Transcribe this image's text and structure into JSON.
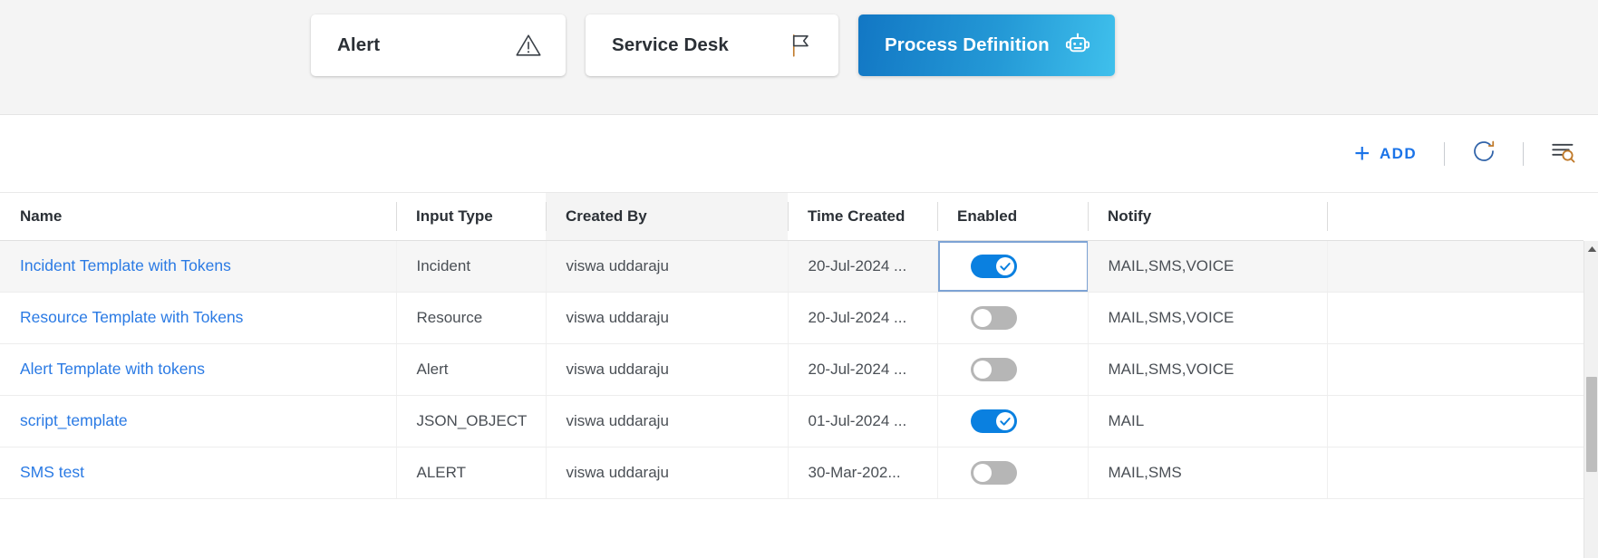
{
  "topbar": {
    "cards": [
      {
        "label": "Alert",
        "icon": "warning-triangle-icon",
        "selected": false
      },
      {
        "label": "Service Desk",
        "icon": "flag-icon",
        "selected": false
      },
      {
        "label": "Process Definition",
        "icon": "robot-icon",
        "selected": true
      }
    ]
  },
  "toolbar": {
    "add_label": "ADD",
    "add_icon": "plus-icon",
    "refresh_icon": "refresh-icon",
    "filter_icon": "filter-search-icon"
  },
  "table": {
    "columns": [
      {
        "label": "Name"
      },
      {
        "label": "Input Type"
      },
      {
        "label": "Created By"
      },
      {
        "label": "Time Created"
      },
      {
        "label": "Enabled"
      },
      {
        "label": "Notify"
      },
      {
        "label": ""
      }
    ],
    "rows": [
      {
        "name": "Incident Template with Tokens",
        "input_type": "Incident",
        "created_by": "viswa uddaraju",
        "time_created": "20-Jul-2024 ...",
        "enabled": true,
        "notify": "MAIL,SMS,VOICE"
      },
      {
        "name": "Resource Template with Tokens",
        "input_type": "Resource",
        "created_by": "viswa uddaraju",
        "time_created": "20-Jul-2024 ...",
        "enabled": false,
        "notify": "MAIL,SMS,VOICE"
      },
      {
        "name": "Alert Template with tokens",
        "input_type": "Alert",
        "created_by": "viswa uddaraju",
        "time_created": "20-Jul-2024 ...",
        "enabled": false,
        "notify": "MAIL,SMS,VOICE"
      },
      {
        "name": "script_template",
        "input_type": "JSON_OBJECT",
        "created_by": "viswa uddaraju",
        "time_created": "01-Jul-2024 ...",
        "enabled": true,
        "notify": "MAIL"
      },
      {
        "name": "SMS test",
        "input_type": "ALERT",
        "created_by": "viswa uddaraju",
        "time_created": "30-Mar-202...",
        "enabled": false,
        "notify": "MAIL,SMS"
      }
    ]
  },
  "colors": {
    "link": "#2a7ae4",
    "accent": "#1a73e8",
    "toggle_on": "#0a80e0",
    "toggle_off": "#b6b6b6",
    "card_selected_start": "#1277c4",
    "card_selected_end": "#3fc0ec"
  },
  "scrollbar": {
    "up_arrow_icon": "caret-up-icon"
  }
}
